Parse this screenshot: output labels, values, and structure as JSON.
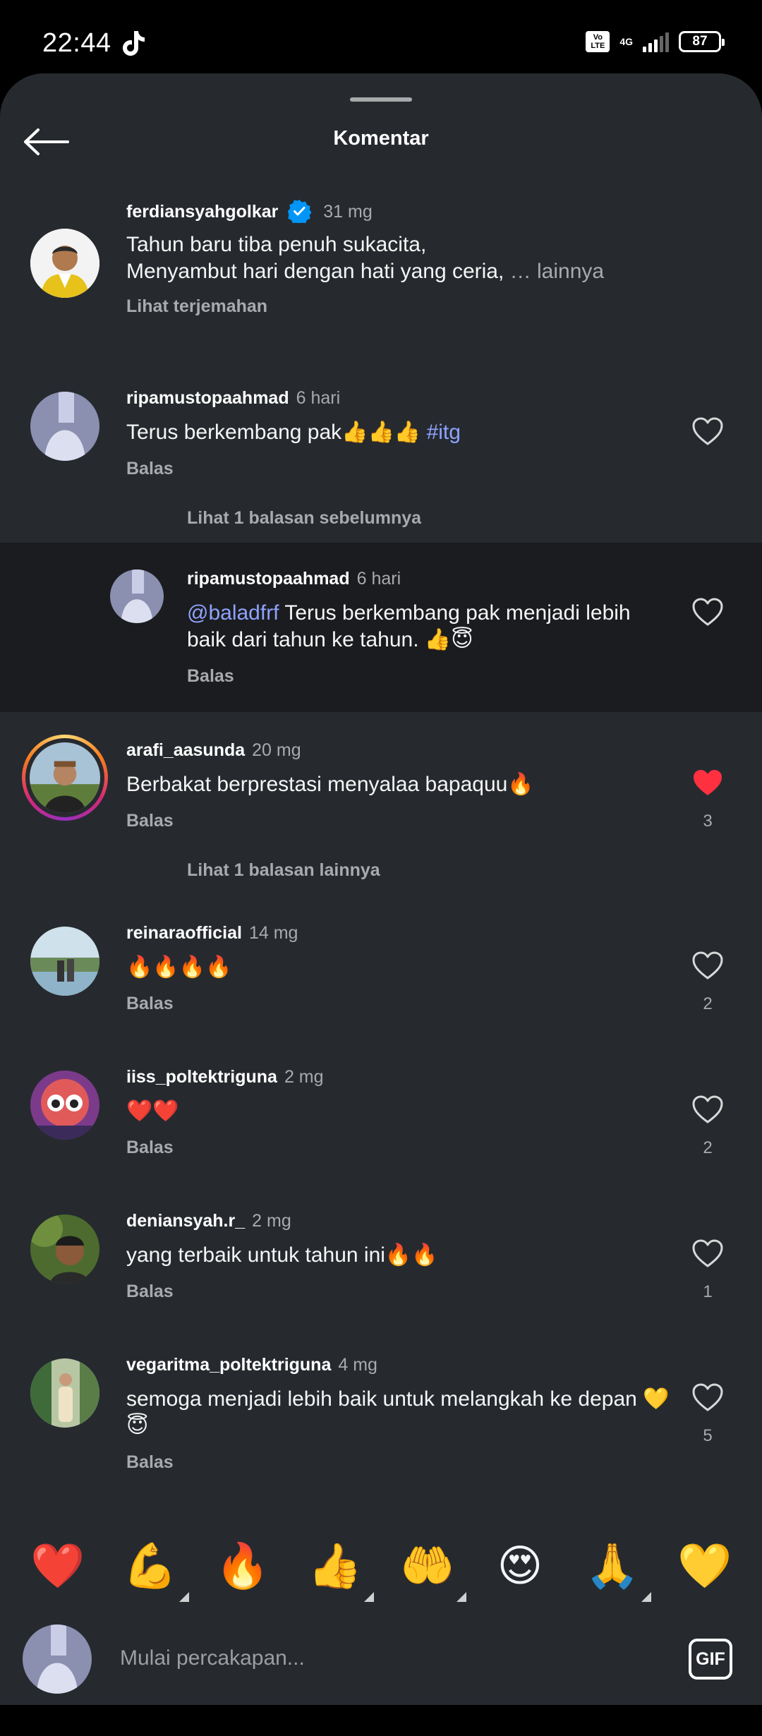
{
  "status": {
    "time": "22:44",
    "volte": "Vo LTE",
    "network": "4G",
    "battery": "87"
  },
  "header": {
    "title": "Komentar"
  },
  "caption": {
    "username": "ferdiansyahgolkar",
    "time": "31 mg",
    "line1": "Tahun baru tiba penuh sukacita,",
    "line2": "Menyambut hari dengan hati yang ceria,",
    "more": "… lainnya",
    "translate": "Lihat terjemahan"
  },
  "comments": [
    {
      "username": "ripamustopaahmad",
      "time": "6 hari",
      "text": "Terus berkembang pak👍👍👍 ",
      "hashtag": "#itg",
      "reply": "Balas"
    },
    {
      "username": "ripamustopaahmad",
      "time": "6 hari",
      "mention": "@baladfrf",
      "text": " Terus berkembang pak menjadi lebih baik dari tahun ke tahun. 👍😇",
      "reply": "Balas"
    },
    {
      "username": "arafi_aasunda",
      "time": "20 mg",
      "text": "Berbakat berprestasi menyalaa bapaquu🔥",
      "reply": "Balas",
      "likes": "3",
      "liked": true
    },
    {
      "username": "reinaraofficial",
      "time": "14 mg",
      "text": "🔥🔥🔥🔥",
      "reply": "Balas",
      "likes": "2"
    },
    {
      "username": "iiss_poltektriguna",
      "time": "2 mg",
      "text": "❤️❤️",
      "reply": "Balas",
      "likes": "2"
    },
    {
      "username": "deniansyah.r_",
      "time": "2 mg",
      "text": "yang terbaik untuk tahun ini🔥🔥",
      "reply": "Balas",
      "likes": "1"
    },
    {
      "username": "vegaritma_poltektriguna",
      "time": "4 mg",
      "text": "semoga menjadi lebih baik untuk melangkah ke depan 💛😇",
      "reply": "Balas",
      "likes": "5"
    }
  ],
  "view_more": {
    "previous": "Lihat 1 balasan sebelumnya",
    "others": "Lihat 1 balasan lainnya"
  },
  "emojis": [
    "❤️",
    "💪",
    "🔥",
    "👍",
    "🤲",
    "😍",
    "🙏",
    "💛"
  ],
  "composer": {
    "placeholder": "Mulai percakapan...",
    "gif": "GIF"
  },
  "colors": {
    "background": "#262a2f",
    "liked": "#ff3040",
    "mention": "#8ea3ff",
    "verified": "#0095f6"
  }
}
